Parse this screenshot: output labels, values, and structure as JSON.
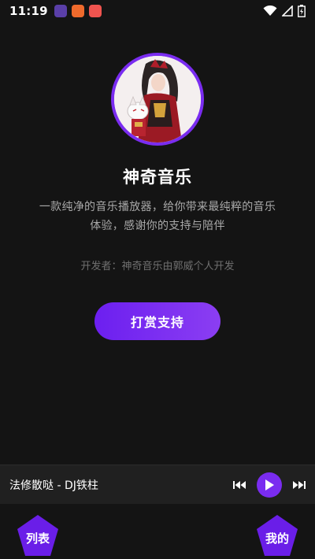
{
  "status_bar": {
    "time": "11:19",
    "notification_icons": [
      "purple-app-icon",
      "orange-app-icon",
      "red-app-icon"
    ],
    "system_icons": [
      "wifi-icon",
      "signal-icon",
      "battery-icon"
    ]
  },
  "profile": {
    "title": "神奇音乐",
    "description": "一款纯净的音乐播放器，给你带来最纯粹的音乐体验，感谢你的支持与陪伴",
    "developer": "开发者：神奇音乐由郭威个人开发",
    "tip_button_label": "打赏支持",
    "avatar_border_color": "#7a2cf0"
  },
  "player": {
    "track_title": "法修散哒 - DJ铁柱",
    "accent_color": "#7a2cf0"
  },
  "bottom_nav": {
    "list_label": "列表",
    "mine_label": "我的"
  }
}
